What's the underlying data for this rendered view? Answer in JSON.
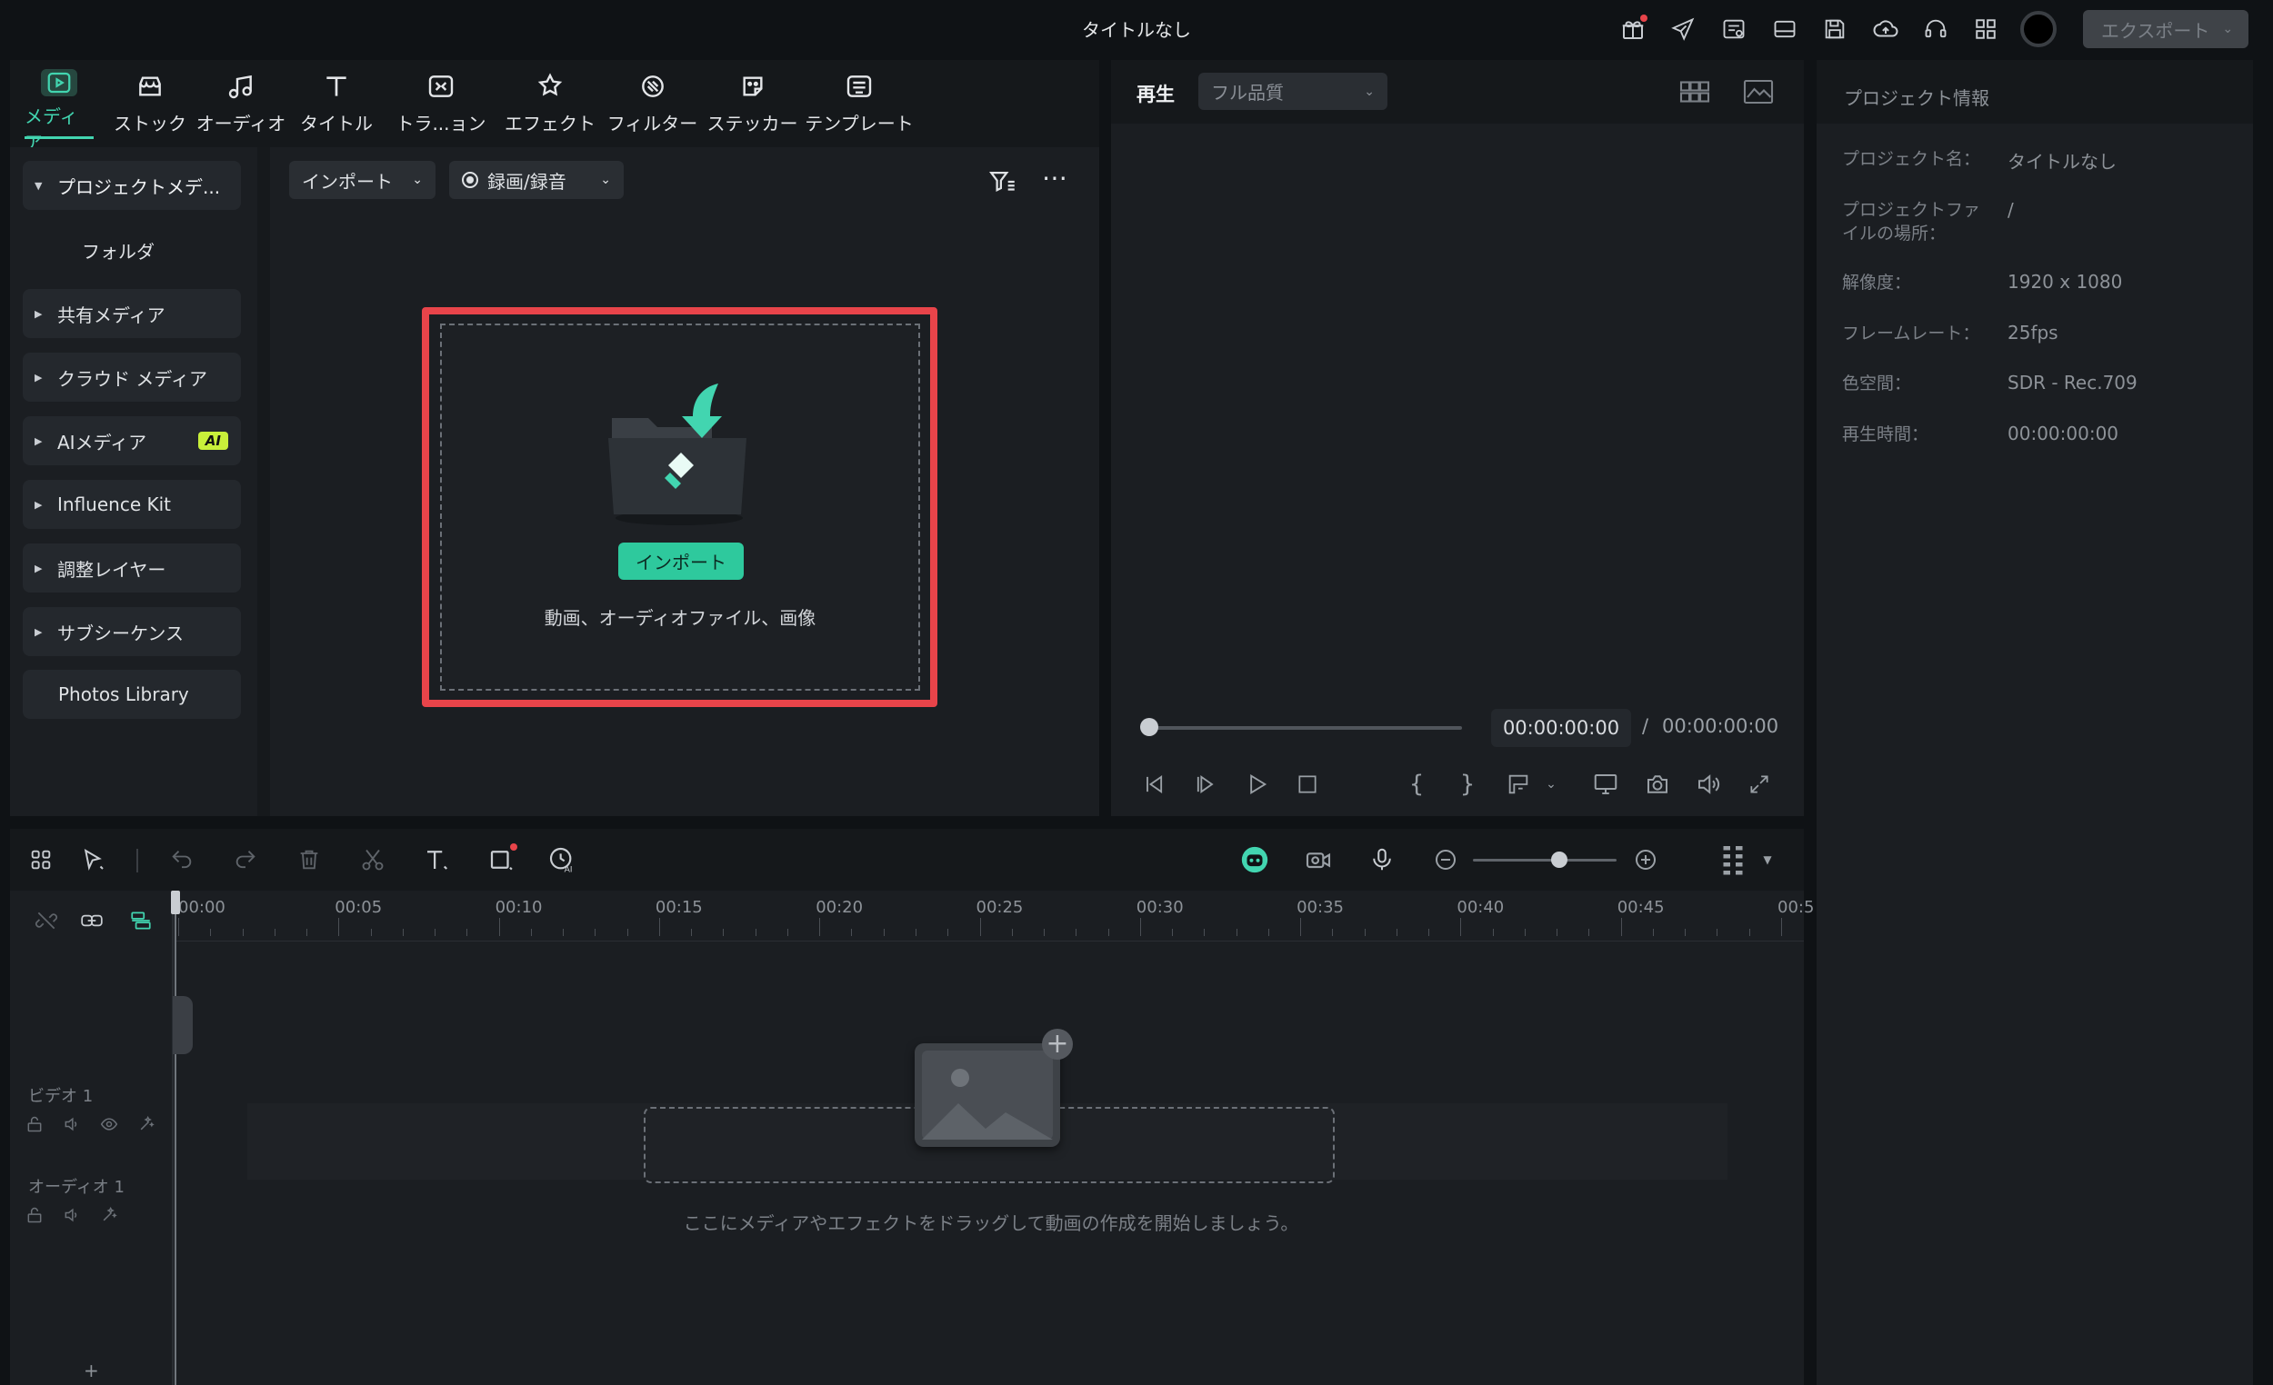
{
  "app": {
    "title": "タイトルなし",
    "export_label": "エクスポート"
  },
  "titlebar_icons": [
    "gift-icon",
    "send-icon",
    "queue-icon",
    "layout-icon",
    "save-icon",
    "cloud-upload-icon",
    "headset-icon",
    "apps-grid-icon",
    "avatar"
  ],
  "colors": {
    "accent": "#42d5b0",
    "import_button": "#2ec99d",
    "highlight": "#e8444a",
    "notify_dot": "#e8444a"
  },
  "media_tabs": [
    {
      "label": "メディア",
      "icon": "media-icon",
      "active": true
    },
    {
      "label": "ストック",
      "icon": "stock-icon"
    },
    {
      "label": "オーディオ",
      "icon": "audio-icon"
    },
    {
      "label": "タイトル",
      "icon": "title-icon"
    },
    {
      "label": "トラ...ョン",
      "icon": "transition-icon"
    },
    {
      "label": "エフェクト",
      "icon": "effects-icon"
    },
    {
      "label": "フィルター",
      "icon": "filter-icon"
    },
    {
      "label": "ステッカー",
      "icon": "sticker-icon"
    },
    {
      "label": "テンプレート",
      "icon": "template-icon"
    }
  ],
  "side_nav": [
    {
      "label": "プロジェクトメデ...",
      "expanded": true
    },
    {
      "label": "フォルダ"
    },
    {
      "label": "共有メディア"
    },
    {
      "label": "クラウド メディア"
    },
    {
      "label": "AIメディア",
      "badge": "AI"
    },
    {
      "label": "Influence Kit"
    },
    {
      "label": "調整レイヤー"
    },
    {
      "label": "サブシーケンス"
    },
    {
      "label": "Photos Library"
    }
  ],
  "media_toolbar": {
    "import_dropdown": "インポート",
    "record_dropdown": "録画/録音"
  },
  "drop_zone": {
    "button_label": "インポート",
    "caption": "動画、オーディオファイル、画像"
  },
  "player": {
    "play_label": "再生",
    "quality": "フル品質",
    "current_time": "00:00:00:00",
    "separator": "/",
    "total_time": "00:00:00:00",
    "progress": 0
  },
  "project_info": {
    "title": "プロジェクト情報",
    "rows": [
      {
        "key": "プロジェクト名：",
        "value": "タイトルなし"
      },
      {
        "key": "プロジェクトファ\nイルの場所：",
        "value": "/"
      },
      {
        "key": "解像度：",
        "value": "1920 x 1080"
      },
      {
        "key": "フレームレート：",
        "value": "25fps"
      },
      {
        "key": "色空間：",
        "value": "SDR - Rec.709"
      },
      {
        "key": "再生時間：",
        "value": "00:00:00:00"
      }
    ]
  },
  "timeline": {
    "ticks": [
      "00:00",
      "00:05",
      "00:10",
      "00:15",
      "00:20",
      "00:25",
      "00:30",
      "00:35",
      "00:40",
      "00:45",
      "00:5"
    ],
    "tracks": [
      {
        "name": "ビデオ 1"
      },
      {
        "name": "オーディオ 1"
      }
    ],
    "hint": "ここにメディアやエフェクトをドラッグして動画の作成を開始しましょう。",
    "add_track": "+",
    "zoom_level": 0.6
  }
}
